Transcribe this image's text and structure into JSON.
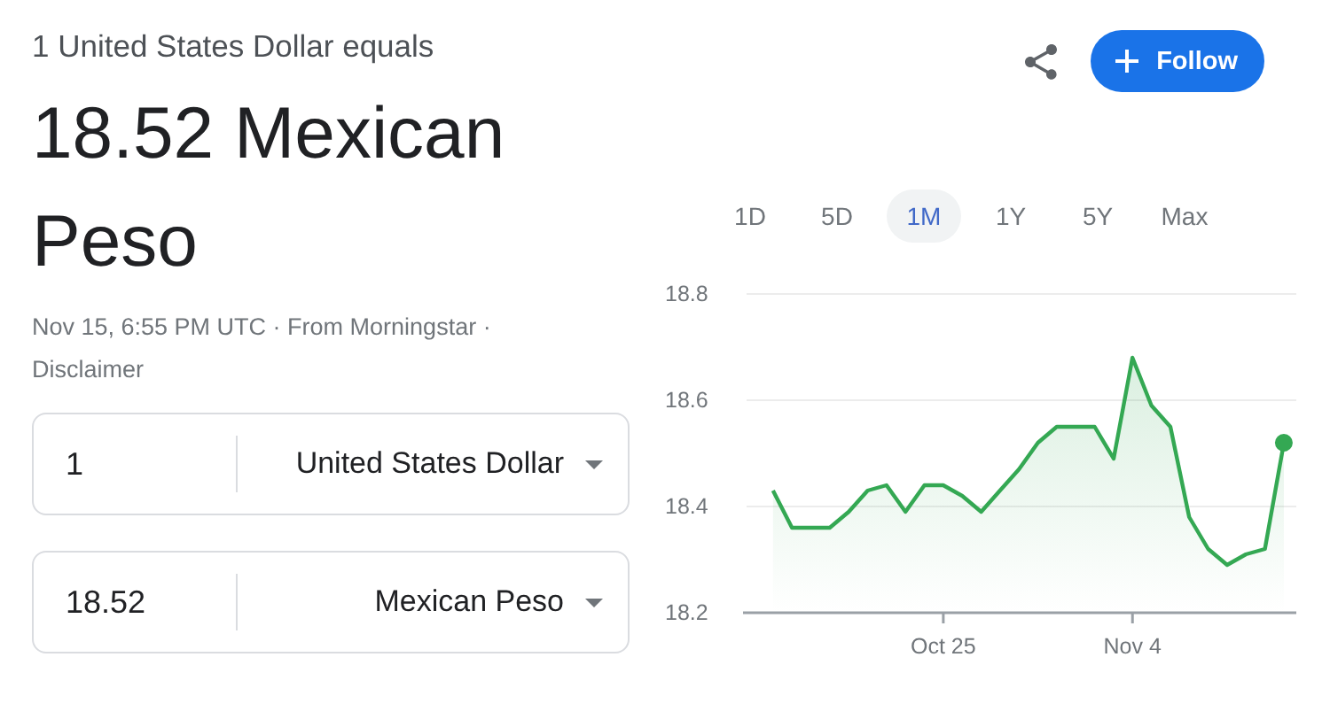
{
  "header": {
    "caption": "1 United States Dollar equals",
    "result": "18.52 Mexican Peso",
    "meta": "Nov 15, 6:55 PM UTC · From Morningstar ·",
    "disclaimer_link": "Disclaimer"
  },
  "follow_button": {
    "label": "Follow"
  },
  "converter": [
    {
      "amount": "1",
      "currency": "United States Dollar"
    },
    {
      "amount": "18.52",
      "currency": "Mexican Peso"
    }
  ],
  "range_tabs": [
    {
      "label": "1D",
      "selected": false
    },
    {
      "label": "5D",
      "selected": false
    },
    {
      "label": "1M",
      "selected": true
    },
    {
      "label": "1Y",
      "selected": false
    },
    {
      "label": "5Y",
      "selected": false
    },
    {
      "label": "Max",
      "selected": false
    }
  ],
  "chart": {
    "chart_data": {
      "type": "area",
      "categories": [
        null,
        null,
        null,
        null,
        null,
        null,
        null,
        null,
        null,
        "Oct 25",
        null,
        null,
        null,
        null,
        null,
        null,
        null,
        null,
        null,
        "Nov 4",
        null,
        null,
        null,
        null,
        null,
        null,
        null,
        null
      ],
      "series": [
        {
          "color": "#34a853",
          "values": [
            18.43,
            18.36,
            18.36,
            18.36,
            18.39,
            18.43,
            18.44,
            18.39,
            18.44,
            18.44,
            18.42,
            18.39,
            18.43,
            18.47,
            18.52,
            18.55,
            18.55,
            18.55,
            18.49,
            18.68,
            18.59,
            18.55,
            18.38,
            18.32,
            18.29,
            18.31,
            18.32,
            18.52
          ]
        }
      ],
      "ylim": [
        18.2,
        18.8
      ],
      "yticks": [
        {
          "value": 18.2,
          "label": "18.2"
        },
        {
          "value": 18.4,
          "label": "18.4"
        },
        {
          "value": 18.6,
          "label": "18.6"
        },
        {
          "value": 18.8,
          "label": "18.8"
        }
      ]
    }
  }
}
